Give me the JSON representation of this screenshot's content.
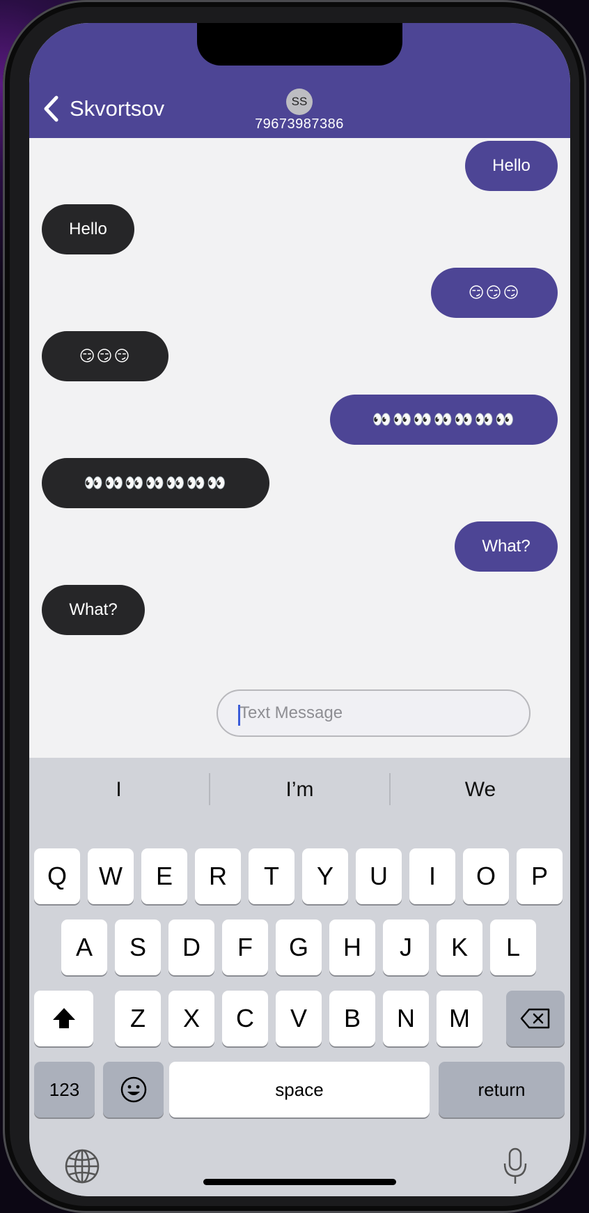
{
  "header": {
    "back_label": "Skvortsov",
    "avatar_initials": "SS",
    "phone_number": "79673987386",
    "color": "#4d4595"
  },
  "messages": [
    {
      "direction": "outgoing",
      "text": "Hello"
    },
    {
      "direction": "incoming",
      "text": "Hello"
    },
    {
      "direction": "outgoing",
      "text": "😏😏😏"
    },
    {
      "direction": "incoming",
      "text": "😏😏😏"
    },
    {
      "direction": "outgoing",
      "text": "👀👀👀👀👀👀👀"
    },
    {
      "direction": "incoming",
      "text": "👀👀👀👀👀👀👀"
    },
    {
      "direction": "outgoing",
      "text": "What?"
    },
    {
      "direction": "incoming",
      "text": "What?"
    }
  ],
  "composer": {
    "placeholder": "Text Message",
    "value": ""
  },
  "keyboard": {
    "suggestions": [
      "I",
      "I’m",
      "We"
    ],
    "row1": [
      "Q",
      "W",
      "E",
      "R",
      "T",
      "Y",
      "U",
      "I",
      "O",
      "P"
    ],
    "row2": [
      "A",
      "S",
      "D",
      "F",
      "G",
      "H",
      "J",
      "K",
      "L"
    ],
    "row3": [
      "Z",
      "X",
      "C",
      "V",
      "B",
      "N",
      "M"
    ],
    "numbers_label": "123",
    "space_label": "space",
    "return_label": "return",
    "icons": {
      "shift": "shift-icon",
      "delete": "backspace-icon",
      "emoji": "emoji-icon",
      "globe": "globe-icon",
      "mic": "microphone-icon"
    }
  },
  "colors": {
    "outgoing_bubble": "#4d4595",
    "incoming_bubble": "#262628",
    "chat_background": "#f2f2f3",
    "keyboard_background": "#d1d3d9"
  }
}
